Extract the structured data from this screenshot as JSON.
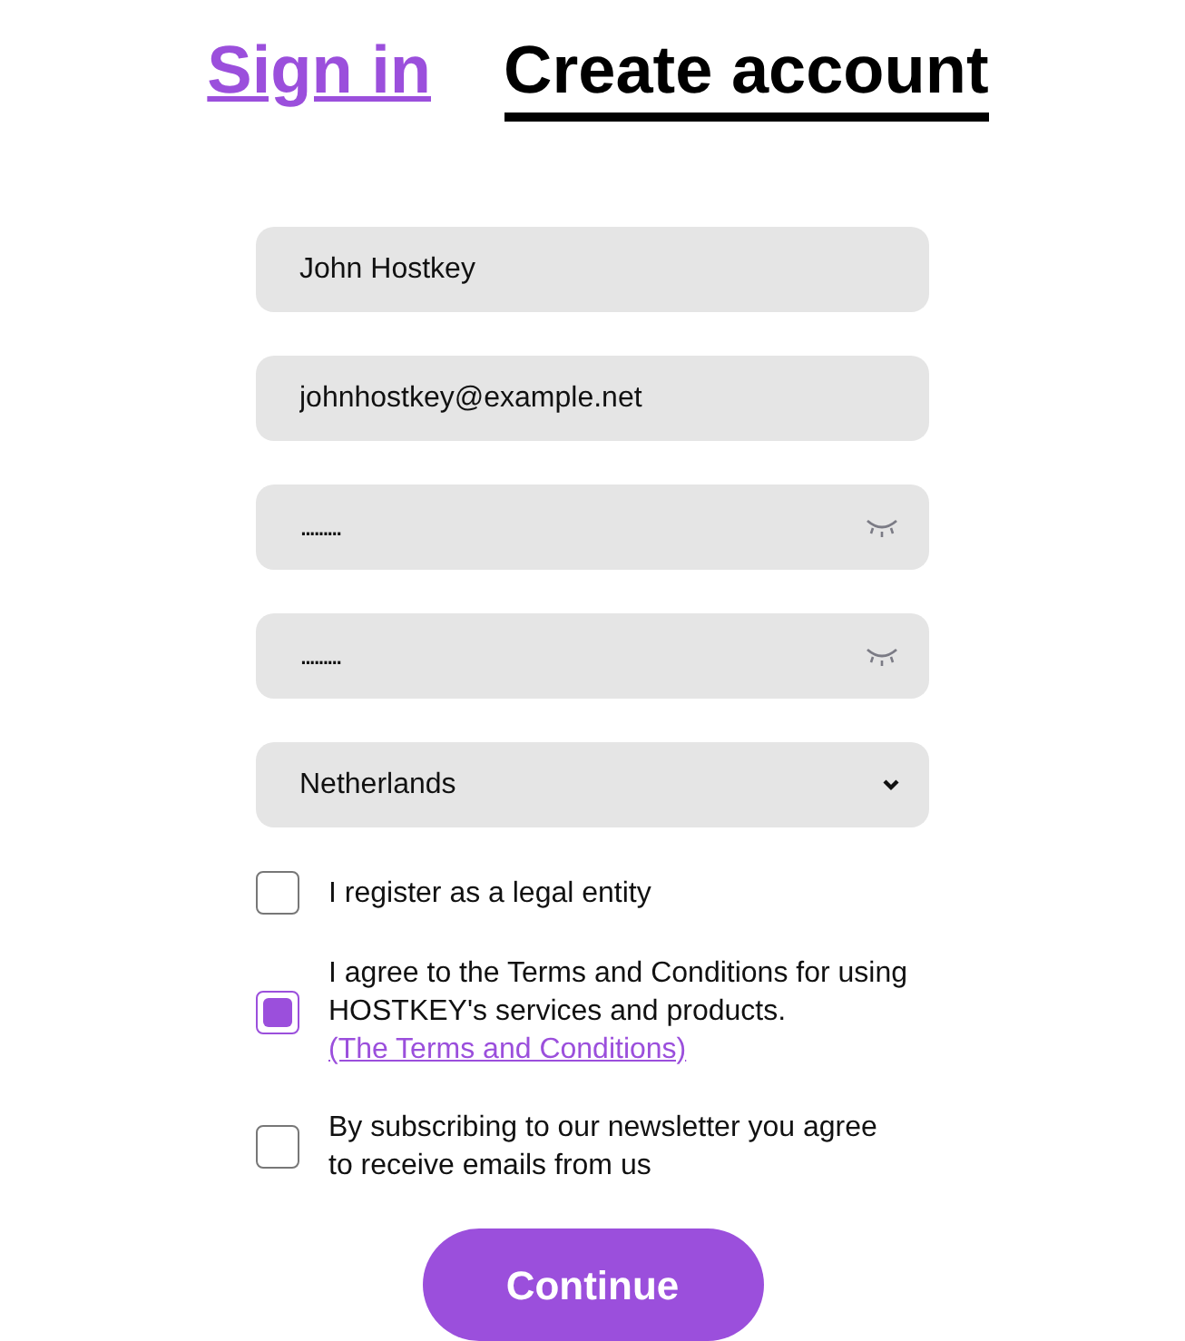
{
  "tabs": [
    {
      "label": "Sign in",
      "selected": false
    },
    {
      "label": "Create account",
      "selected": true
    }
  ],
  "fields": [
    {
      "kind": "text",
      "value": "John Hostkey"
    },
    {
      "kind": "text",
      "value": "johnhostkey@example.net"
    },
    {
      "kind": "password",
      "value": "........."
    },
    {
      "kind": "password",
      "value": "........."
    },
    {
      "kind": "select",
      "value": "Netherlands"
    }
  ],
  "checkboxes": [
    {
      "label": "I register as a legal entity",
      "checked": false
    },
    {
      "label": "I agree to the Terms and Conditions for using HOSTKEY's services and products.",
      "link": "(The Terms and Conditions)",
      "checked": true
    },
    {
      "label": "By subscribing to our newsletter you agree to receive emails from us",
      "checked": false
    }
  ],
  "submit": "Continue"
}
